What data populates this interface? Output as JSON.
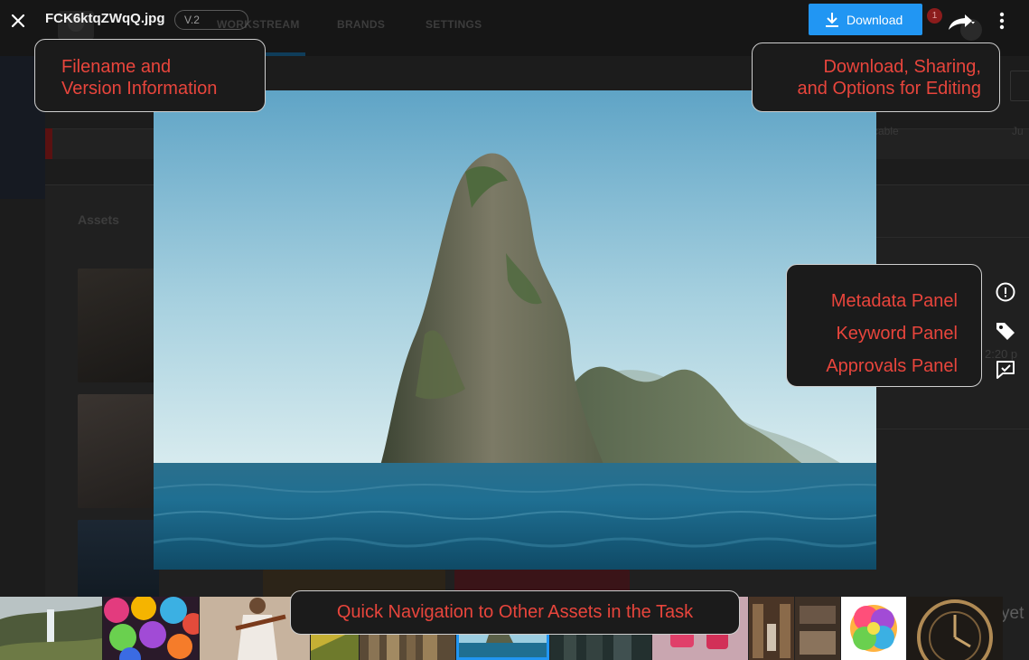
{
  "viewer": {
    "filename": "FCK6ktqZWqQ.jpg",
    "version": "V.2",
    "download_label": "Download",
    "notification_count": "1"
  },
  "background": {
    "nav_tabs": [
      "WORKSTREAM",
      "BRANDS",
      "SETTINGS"
    ],
    "assets_heading": "Assets",
    "row_text_1": "cable",
    "row_text_2": "Ju",
    "right_time": "2:20 p",
    "right_snippet": "yet",
    "right_snippet2": "e"
  },
  "callouts": {
    "filename_version": [
      "Filename and",
      "Version Information"
    ],
    "download_sharing": [
      "Download, Sharing,",
      "and Options for Editing"
    ],
    "metadata": "Metadata Panel",
    "keyword": "Keyword Panel",
    "approvals": "Approvals Panel",
    "quick_nav": "Quick Navigation to Other Assets in the Task"
  },
  "colors": {
    "accent": "#2196f3",
    "callout_text": "#e8453c",
    "badge": "#8b1c1c"
  },
  "icons": {
    "close": "close-icon",
    "download": "download-icon",
    "share": "share-icon",
    "more": "more-vertical-icon",
    "metadata": "alert-circle-icon",
    "keyword": "tag-icon",
    "approvals": "approval-check-icon"
  },
  "filmstrip": {
    "selected_index": 6,
    "items": [
      "waterfall",
      "rainbow-roses",
      "violinist",
      "aerial-field",
      "city-aerial",
      "island-sea",
      "dark-city",
      "pink-cups",
      "library",
      "cafe-interior",
      "color-flower",
      "clock-face"
    ]
  }
}
